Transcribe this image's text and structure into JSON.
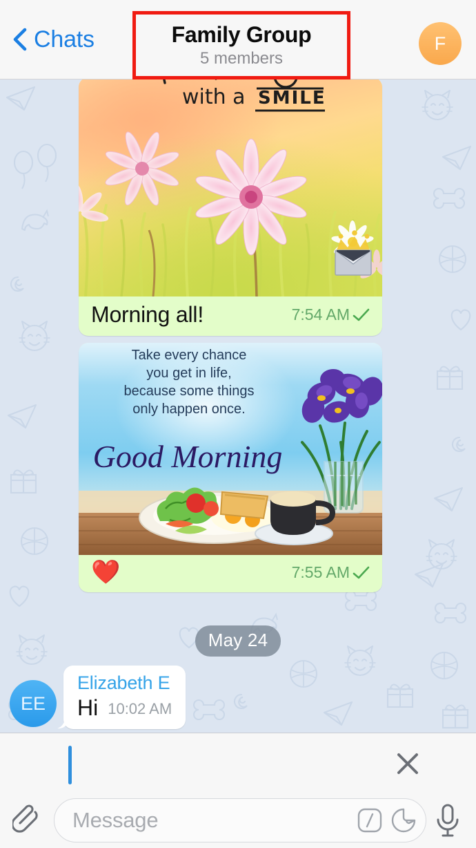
{
  "header": {
    "back_label": "Chats",
    "back_icon": "chevron-left-icon",
    "title": "Family Group",
    "subtitle": "5 members",
    "avatar_initial": "F",
    "avatar_color": "#f9a84c",
    "accent_color": "#1b7fe3",
    "highlight_box_color": "#f01b12"
  },
  "messages": [
    {
      "type": "photo-out",
      "image_alt": "sunny-flower-field-photo",
      "image_text_line": "with a SMILE",
      "image_badge": "envelope-with-crown-graphic",
      "caption": "Morning all!",
      "time": "7:54 AM",
      "status_icon": "single-check-icon"
    },
    {
      "type": "photo-out",
      "image_alt": "good-morning-breakfast-photo",
      "image_quote": "Take every chance\nyou get in life,\nbecause some things\nonly happen once.",
      "image_title": "Good Morning",
      "caption_emoji": "❤️",
      "time": "7:55 AM",
      "status_icon": "single-check-icon"
    }
  ],
  "date_divider": "May 24",
  "incoming": {
    "avatar_initials": "EE",
    "avatar_color": "#2a9aea",
    "sender": "Elizabeth E",
    "sender_color": "#35a3e8",
    "text": "Hi",
    "time": "10:02 AM"
  },
  "composer": {
    "reply_close_icon": "close-icon",
    "attach_icon": "paperclip-icon",
    "placeholder": "Message",
    "command_icon": "slash-command-icon",
    "sticker_icon": "sticker-icon",
    "mic_icon": "microphone-icon"
  },
  "bubble_colors": {
    "outgoing": "#e3fdc9",
    "incoming": "#ffffff",
    "chat_background": "#dce5f1",
    "meta_green": "#63a869"
  }
}
